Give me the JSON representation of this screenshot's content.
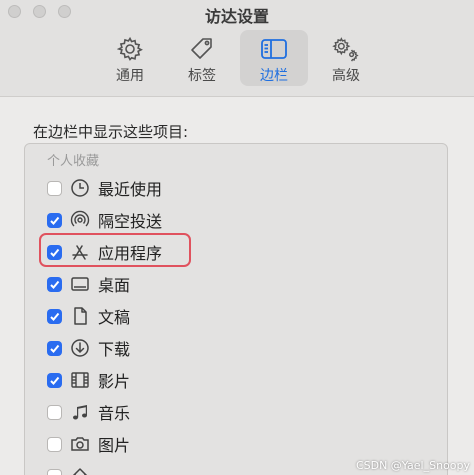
{
  "window": {
    "title": "访达设置"
  },
  "toolbar": {
    "tabs": [
      {
        "label": "通用",
        "icon": "gear-icon"
      },
      {
        "label": "标签",
        "icon": "tag-icon"
      },
      {
        "label": "边栏",
        "icon": "sidebar-icon",
        "selected": true
      },
      {
        "label": "高级",
        "icon": "gears-icon"
      }
    ]
  },
  "sidebar_settings": {
    "heading": "在边栏中显示这些项目:",
    "group_header": "个人收藏",
    "items": [
      {
        "label": "最近使用",
        "icon": "clock-icon",
        "checked": false
      },
      {
        "label": "隔空投送",
        "icon": "airdrop-icon",
        "checked": true
      },
      {
        "label": "应用程序",
        "icon": "applications-icon",
        "checked": true
      },
      {
        "label": "桌面",
        "icon": "desktop-icon",
        "checked": true
      },
      {
        "label": "文稿",
        "icon": "document-icon",
        "checked": true
      },
      {
        "label": "下载",
        "icon": "download-icon",
        "checked": true
      },
      {
        "label": "影片",
        "icon": "film-icon",
        "checked": true
      },
      {
        "label": "音乐",
        "icon": "music-icon",
        "checked": false
      },
      {
        "label": "图片",
        "icon": "camera-icon",
        "checked": false
      },
      {
        "label": "",
        "icon": "home-icon",
        "checked": false
      }
    ]
  },
  "watermark": "CSDN @Yael_Snoopy",
  "colors": {
    "accent": "#2a6cf0",
    "highlight": "#e0525e"
  }
}
